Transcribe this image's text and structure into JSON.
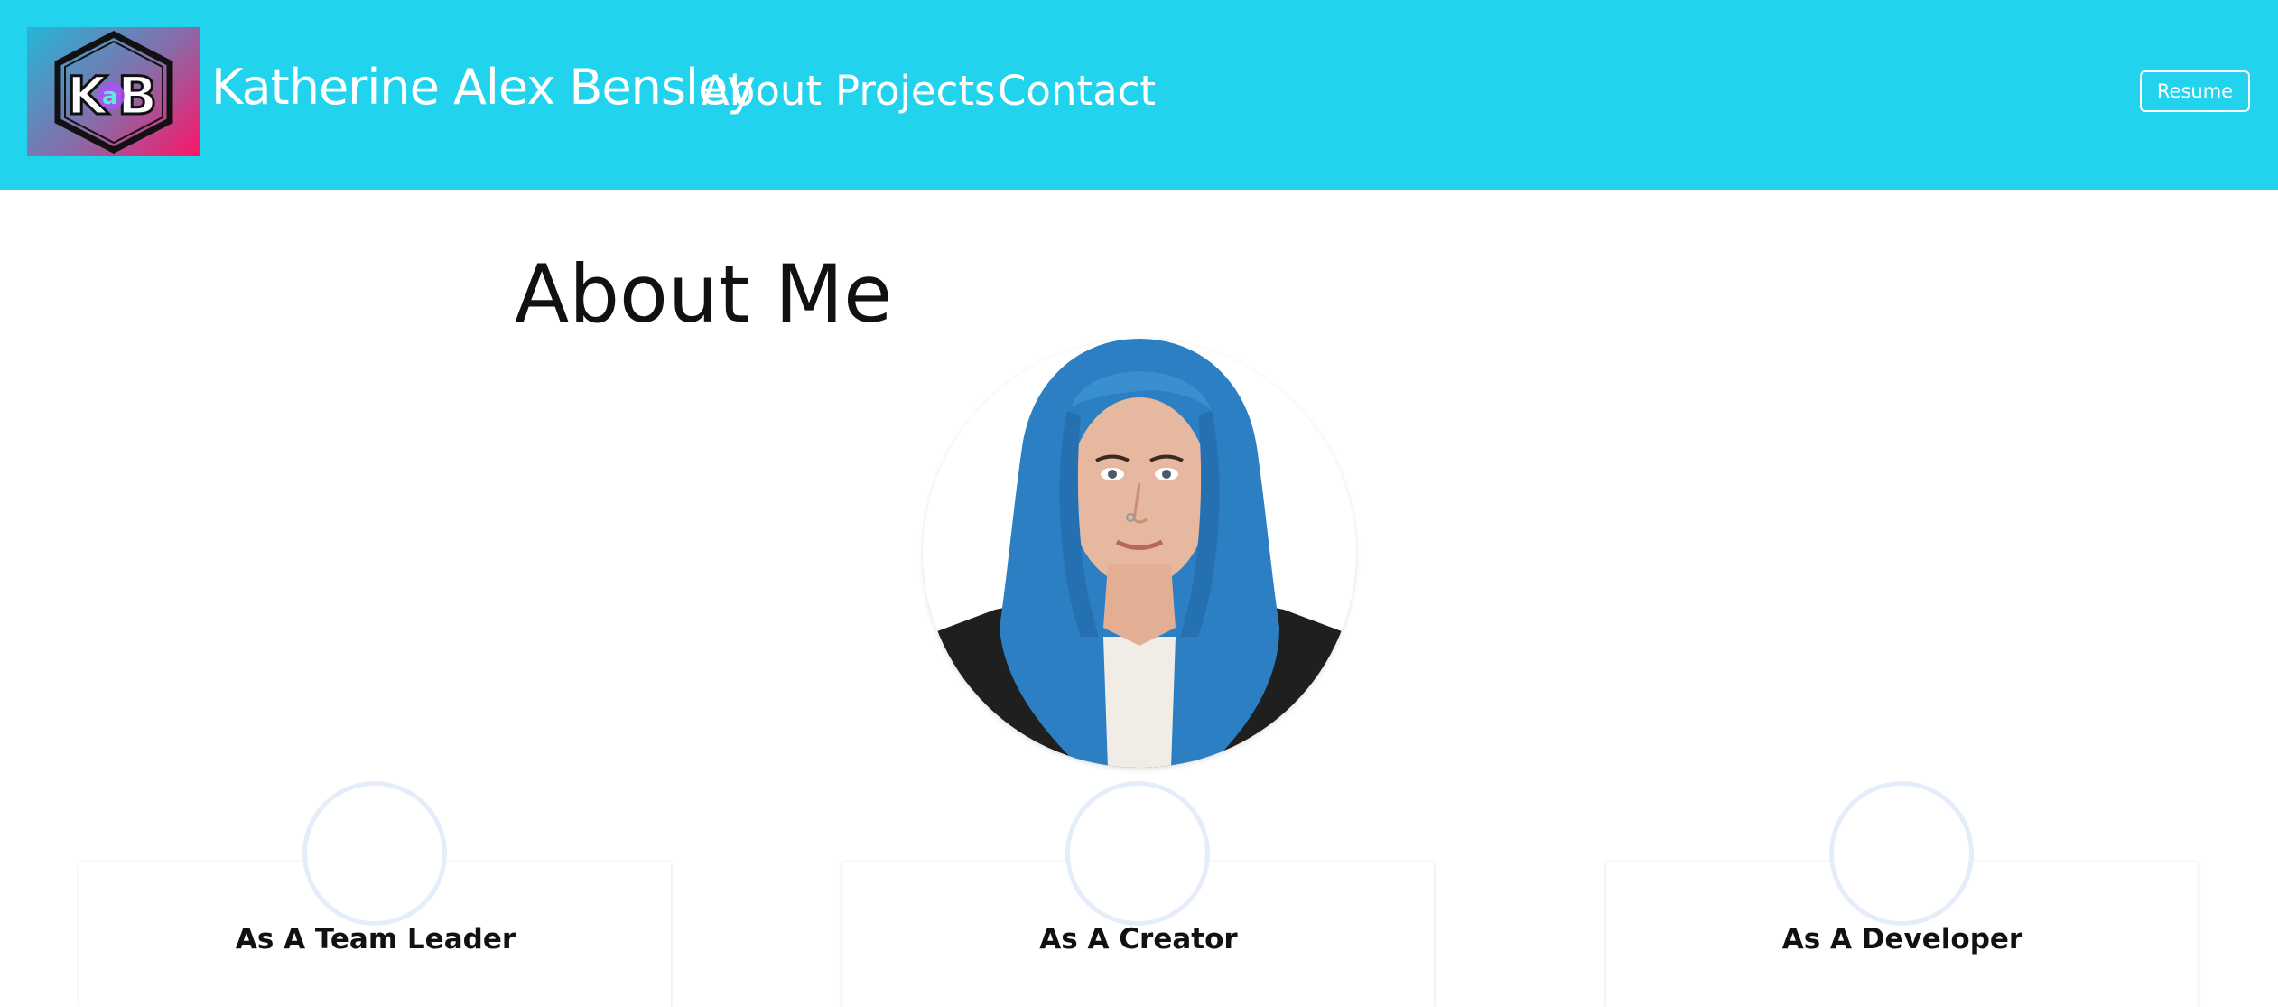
{
  "header": {
    "logo_text": "K@B",
    "brand_name": "Katherine Alex Bensley",
    "nav_links": [
      "About",
      "Projects",
      "Contact"
    ],
    "resume_label": "Resume"
  },
  "main": {
    "title": "About Me",
    "cards": [
      {
        "title": "As A Team Leader"
      },
      {
        "title": "As A Creator"
      },
      {
        "title": "As A Developer"
      }
    ]
  },
  "colors": {
    "header_bg": "#22d3ee",
    "logo_gradient_start": "#22b7d8",
    "logo_gradient_end": "#ff1366",
    "hair_blue": "#2b7fc2",
    "card_circle_border": "#e5edfb"
  },
  "icons": {
    "logo": "kab-hexagon-logo",
    "portrait": "profile-photo"
  }
}
